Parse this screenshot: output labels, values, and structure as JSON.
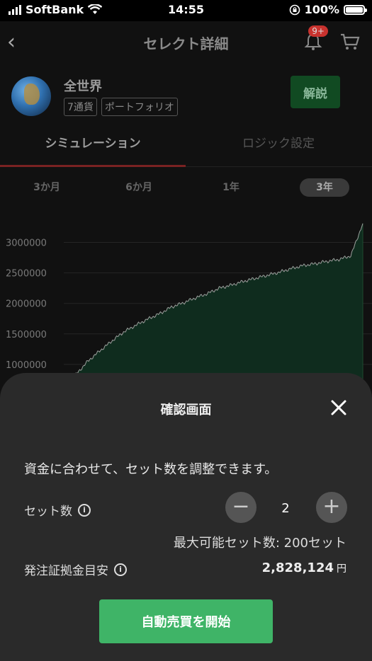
{
  "status_bar": {
    "carrier": "SoftBank",
    "time": "14:55",
    "battery": "100%"
  },
  "header": {
    "title": "セレクト詳細",
    "notification_badge": "9+"
  },
  "select": {
    "title": "全世界",
    "tags": [
      "7通貨",
      "ポートフォリオ"
    ],
    "explain_button": "解説"
  },
  "tabs": [
    {
      "label": "シミュレーション"
    },
    {
      "label": "ロジック設定"
    }
  ],
  "periods": [
    {
      "label": "3か月"
    },
    {
      "label": "6か月"
    },
    {
      "label": "1年"
    },
    {
      "label": "3年"
    }
  ],
  "selected_period": "3年",
  "chart_data": {
    "type": "area",
    "y_ticks": [
      "3000000",
      "2500000",
      "2000000",
      "1500000",
      "1000000"
    ],
    "x": [
      0,
      4,
      8,
      12,
      16,
      20,
      24,
      28,
      32,
      36,
      40,
      44,
      48,
      52,
      56,
      60,
      64,
      68,
      72,
      76,
      80,
      84,
      88,
      92,
      96,
      100
    ],
    "y": [
      500000,
      830000,
      1050000,
      1220000,
      1380000,
      1530000,
      1640000,
      1740000,
      1830000,
      1940000,
      2010000,
      2090000,
      2160000,
      2250000,
      2300000,
      2360000,
      2410000,
      2460000,
      2510000,
      2570000,
      2620000,
      2650000,
      2690000,
      2720000,
      2780000,
      3310000
    ],
    "ylim": [
      500000,
      3400000
    ],
    "grid": true
  },
  "modal": {
    "title": "確認画面",
    "description": "資金に合わせて、セット数を調整できます。",
    "set_label": "セット数",
    "set_quantity": "2",
    "max_sets": "最大可能セット数: 200セット",
    "deposit_label": "発注証拠金目安",
    "deposit_value": "2,828,124",
    "deposit_unit": "円",
    "start_button": "自動売買を開始"
  },
  "colors": {
    "accent_green": "#3fb467",
    "sheet_bg": "#2a2a2a",
    "badge_red": "#c8322e"
  }
}
